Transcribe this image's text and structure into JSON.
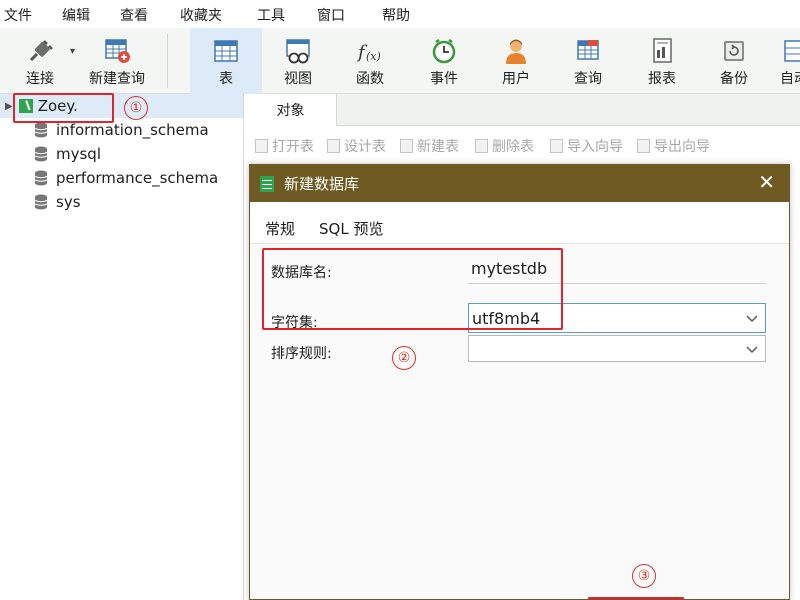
{
  "menu": [
    "文件",
    "编辑",
    "查看",
    "收藏夹",
    "工具",
    "窗口",
    "帮助"
  ],
  "toolbar": {
    "connect": "连接",
    "new_query": "新建查询",
    "table": "表",
    "view": "视图",
    "function": "函数",
    "event": "事件",
    "user": "用户",
    "query": "查询",
    "report": "报表",
    "backup": "备份",
    "auto": "自动"
  },
  "sidebar": {
    "connection": "Zoey.",
    "databases": [
      "information_schema",
      "mysql",
      "performance_schema",
      "sys"
    ]
  },
  "main": {
    "tab": "对象",
    "object_toolbar": [
      "打开表",
      "设计表",
      "新建表",
      "删除表",
      "导入向导",
      "导出向导"
    ]
  },
  "dialog": {
    "title": "新建数据库",
    "close": "✕",
    "tabs": [
      "常规",
      "SQL 预览"
    ],
    "fields": {
      "db_name_label": "数据库名:",
      "db_name_value": "mytestdb",
      "charset_label": "字符集:",
      "charset_value": "utf8mb4",
      "collation_label": "排序规则:",
      "collation_value": ""
    }
  },
  "annotations": {
    "step1": "①",
    "step2": "②",
    "step3": "③"
  },
  "colors": {
    "title_bar": "#6e5a22",
    "annotation": "#e0242c",
    "active_tool": "#dcebf7",
    "focus_border": "#5a9bd5"
  }
}
